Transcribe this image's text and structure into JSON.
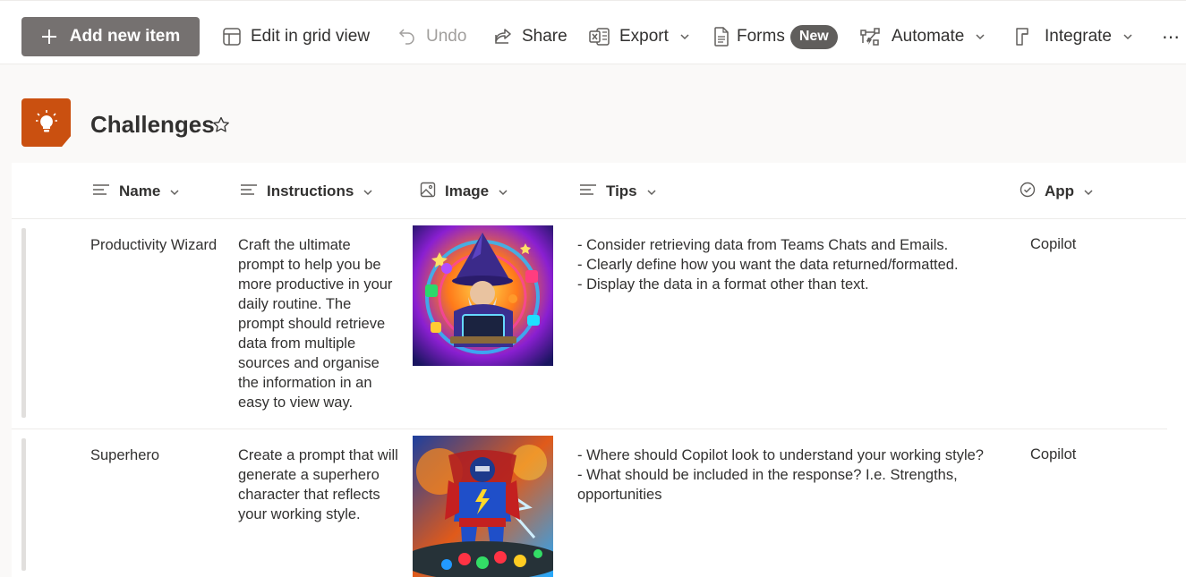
{
  "commandbar": {
    "add_new_item": "Add new item",
    "edit_grid": "Edit in grid view",
    "undo": "Undo",
    "share": "Share",
    "export": "Export",
    "forms": "Forms",
    "forms_badge": "New",
    "automate": "Automate",
    "integrate": "Integrate",
    "more": "⋯"
  },
  "list": {
    "title": "Challenges",
    "icon": "lightbulb-icon",
    "accent_color": "#ca5010",
    "columns": [
      "Name",
      "Instructions",
      "Image",
      "Tips",
      "App"
    ],
    "rows": [
      {
        "name": "Productivity Wizard",
        "instructions": "Craft the ultimate prompt to help you be more productive in your daily routine. The prompt should retrieve data from multiple sources and organise the information in an easy to view way.",
        "image": "wizard-with-laptop-illustration",
        "tips": [
          "- Consider retrieving data from Teams Chats and Emails.",
          "- Clearly define how you want the data returned/formatted.",
          "- Display the data in a format other than text."
        ],
        "app": "Copilot"
      },
      {
        "name": "Superhero",
        "instructions": "Create a prompt that will generate a superhero character that reflects your working style.",
        "image": "superhero-illustration",
        "tips": [
          "- Where should Copilot look to understand your working style?",
          "- What should be included in the response? I.e. Strengths, opportunities"
        ],
        "app": "Copilot"
      }
    ]
  }
}
